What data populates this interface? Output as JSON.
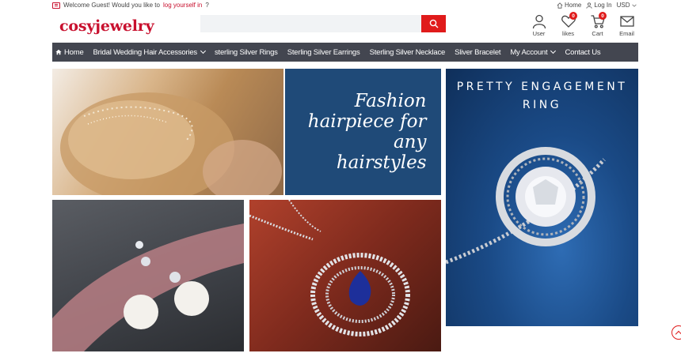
{
  "topbar": {
    "welcome_prefix": "Welcome Guest! Would you like to",
    "welcome_link": "log yourself in",
    "welcome_suffix": "?",
    "home": "Home",
    "login": "Log In",
    "currency": "USD"
  },
  "logo": "cosyjewelry",
  "search": {
    "placeholder": "",
    "value": ""
  },
  "header_icons": {
    "user": "User",
    "likes": "likes",
    "likes_count": "0",
    "cart": "Cart",
    "cart_count": "0",
    "email": "Email"
  },
  "nav": {
    "items": [
      {
        "label": "Home"
      },
      {
        "label": "Bridal Wedding Hair Accessories"
      },
      {
        "label": "sterling Silver Rings"
      },
      {
        "label": "Sterling Silver Earrings"
      },
      {
        "label": "Sterling Silver Necklace"
      },
      {
        "label": "Sliver Bracelet"
      },
      {
        "label": "My Account"
      },
      {
        "label": "Contact Us"
      }
    ]
  },
  "banners": {
    "hairpiece_text": "Fashion hairpiece for any hairstyles",
    "ring_text": "PRETTY ENGAGEMENT RING"
  },
  "colors": {
    "brand": "#c8102e",
    "nav_bg": "#434650",
    "accent_red": "#e01b1b",
    "panel_blue": "#1f4a78"
  }
}
